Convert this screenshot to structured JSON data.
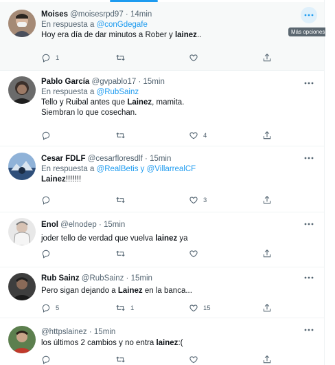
{
  "tooltip_more": "Más opciones",
  "tweets": [
    {
      "name": "Moises",
      "handle": "@moisesrpd97",
      "time": "14min",
      "reply_prefix": "En respuesta a",
      "reply_to": "@conGdegafe",
      "text_before": "Hoy era día de dar minutos a Rober y ",
      "text_bold": "lainez",
      "text_after": "..",
      "replies": "1",
      "retweets": "",
      "likes": ""
    },
    {
      "name": "Pablo García",
      "handle": "@gvpablo17",
      "time": "15min",
      "reply_prefix": "En respuesta a",
      "reply_to": "@RubSainz",
      "line1_before": "Tello y Ruibal antes que ",
      "line1_bold": "Lainez",
      "line1_after": ", mamita.",
      "line2": "Siembran lo que cosechan.",
      "replies": "",
      "retweets": "",
      "likes": "4"
    },
    {
      "name": "Cesar FDLF",
      "handle": "@cesarfloresdlf",
      "time": "15min",
      "reply_prefix": "En respuesta a",
      "reply_to_1": "@RealBetis",
      "reply_joiner": "y",
      "reply_to_2": "@VillarrealCF",
      "text_bold": "Lainez",
      "text_after": "!!!!!!!",
      "replies": "",
      "retweets": "",
      "likes": "3"
    },
    {
      "name": "Enol",
      "handle": "@elnodep",
      "time": "15min",
      "text_before": "joder tello de verdad que vuelva ",
      "text_bold": "lainez",
      "text_after": " ya",
      "replies": "",
      "retweets": "",
      "likes": ""
    },
    {
      "name": "Rub Sainz",
      "handle": "@RubSainz",
      "time": "15min",
      "text_before": "Pero sigan dejando a ",
      "text_bold": "Lainez",
      "text_after": " en la banca...",
      "replies": "5",
      "retweets": "1",
      "likes": "15"
    },
    {
      "name": "",
      "handle": "@httpslainez",
      "time": "15min",
      "text_before": "los últimos 2 cambios y no entra ",
      "text_bold": "lainez",
      "text_after": ":(",
      "replies": "",
      "retweets": "",
      "likes": ""
    }
  ]
}
